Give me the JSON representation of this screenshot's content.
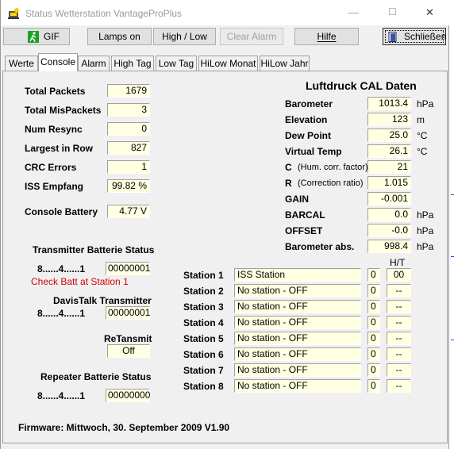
{
  "window": {
    "title": "Status Wetterstation VantageProPlus",
    "minimize": "—",
    "maximize": "☐",
    "close": "✕"
  },
  "toolbar": {
    "gif": "GIF",
    "lamps_on": "Lamps on",
    "high_low": "High / Low",
    "clear_alarm": "Clear Alarm",
    "hilfe": "Hilfe",
    "schliessen": "Schließen"
  },
  "tabs": [
    "Werte",
    "Console",
    "Alarm",
    "High Tag",
    "Low Tag",
    "HiLow Monat",
    "HiLow Jahr"
  ],
  "active_tab": "Console",
  "console": {
    "total_packets": {
      "label": "Total Packets",
      "value": "1679"
    },
    "total_mispackets": {
      "label": "Total MisPackets",
      "value": "3"
    },
    "num_resync": {
      "label": "Num Resync",
      "value": "0"
    },
    "largest_in_row": {
      "label": "Largest in Row",
      "value": "827"
    },
    "crc_errors": {
      "label": "CRC Errors",
      "value": "1"
    },
    "iss_empfang": {
      "label": "ISS Empfang",
      "value": "99.82 %"
    },
    "console_battery": {
      "label": "Console Battery",
      "value": "4.77 V"
    }
  },
  "transmitter": {
    "heading": "Transmitter Batterie Status",
    "bits_label": "8......4......1",
    "bits_value": "00000001",
    "warning": "Check Batt at Station 1"
  },
  "davistalk": {
    "heading": "DavisTalk Transmitter",
    "bits_label": "8......4......1",
    "bits_value": "00000001"
  },
  "retransmit": {
    "heading": "ReTansmit",
    "value": "Off"
  },
  "repeater": {
    "heading": "Repeater Batterie Status",
    "bits_label": "8......4......1",
    "bits_value": "00000000"
  },
  "firmware": "Firmware:  Mittwoch, 30. September 2009  V1.90",
  "cal": {
    "heading": "Luftdruck CAL Daten",
    "rows": [
      {
        "label": "Barometer",
        "sub": "",
        "value": "1013.4",
        "unit": "hPa"
      },
      {
        "label": "Elevation",
        "sub": "",
        "value": "123",
        "unit": "m"
      },
      {
        "label": "Dew Point",
        "sub": "",
        "value": "25.0",
        "unit": "°C"
      },
      {
        "label": "Virtual Temp",
        "sub": "",
        "value": "26.1",
        "unit": "°C"
      },
      {
        "label": "C",
        "sub": "(Hum. corr. factor)",
        "value": "21",
        "unit": ""
      },
      {
        "label": "R",
        "sub": "(Correction ratio)",
        "value": "1.015",
        "unit": ""
      },
      {
        "label": "GAIN",
        "sub": "",
        "value": "-0.001",
        "unit": ""
      },
      {
        "label": "BARCAL",
        "sub": "",
        "value": "0.0",
        "unit": "hPa"
      },
      {
        "label": "OFFSET",
        "sub": "",
        "value": "-0.0",
        "unit": "hPa"
      },
      {
        "label": "Barometer abs.",
        "sub": "",
        "value": "998.4",
        "unit": "hPa"
      }
    ]
  },
  "stations": {
    "ht_header": "H/T",
    "rows": [
      {
        "label": "Station 1",
        "name": "ISS Station",
        "num": "0",
        "ht": "00"
      },
      {
        "label": "Station 2",
        "name": "No station - OFF",
        "num": "0",
        "ht": "--"
      },
      {
        "label": "Station 3",
        "name": "No station - OFF",
        "num": "0",
        "ht": "--"
      },
      {
        "label": "Station 4",
        "name": "No station - OFF",
        "num": "0",
        "ht": "--"
      },
      {
        "label": "Station 5",
        "name": "No station - OFF",
        "num": "0",
        "ht": "--"
      },
      {
        "label": "Station 6",
        "name": "No station - OFF",
        "num": "0",
        "ht": "--"
      },
      {
        "label": "Station 7",
        "name": "No station - OFF",
        "num": "0",
        "ht": "--"
      },
      {
        "label": "Station 8",
        "name": "No station - OFF",
        "num": "0",
        "ht": "--"
      }
    ]
  }
}
